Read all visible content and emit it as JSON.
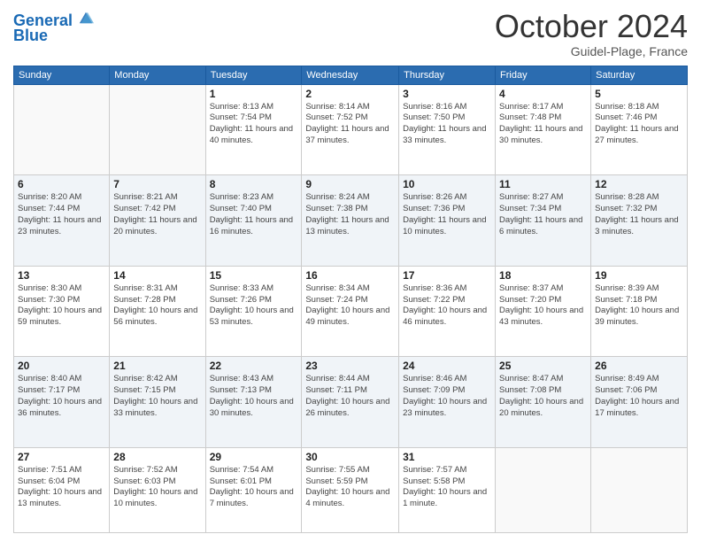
{
  "header": {
    "logo_line1": "General",
    "logo_line2": "Blue",
    "month": "October 2024",
    "location": "Guidel-Plage, France"
  },
  "days_of_week": [
    "Sunday",
    "Monday",
    "Tuesday",
    "Wednesday",
    "Thursday",
    "Friday",
    "Saturday"
  ],
  "weeks": [
    [
      {
        "num": "",
        "info": ""
      },
      {
        "num": "",
        "info": ""
      },
      {
        "num": "1",
        "info": "Sunrise: 8:13 AM\nSunset: 7:54 PM\nDaylight: 11 hours and 40 minutes."
      },
      {
        "num": "2",
        "info": "Sunrise: 8:14 AM\nSunset: 7:52 PM\nDaylight: 11 hours and 37 minutes."
      },
      {
        "num": "3",
        "info": "Sunrise: 8:16 AM\nSunset: 7:50 PM\nDaylight: 11 hours and 33 minutes."
      },
      {
        "num": "4",
        "info": "Sunrise: 8:17 AM\nSunset: 7:48 PM\nDaylight: 11 hours and 30 minutes."
      },
      {
        "num": "5",
        "info": "Sunrise: 8:18 AM\nSunset: 7:46 PM\nDaylight: 11 hours and 27 minutes."
      }
    ],
    [
      {
        "num": "6",
        "info": "Sunrise: 8:20 AM\nSunset: 7:44 PM\nDaylight: 11 hours and 23 minutes."
      },
      {
        "num": "7",
        "info": "Sunrise: 8:21 AM\nSunset: 7:42 PM\nDaylight: 11 hours and 20 minutes."
      },
      {
        "num": "8",
        "info": "Sunrise: 8:23 AM\nSunset: 7:40 PM\nDaylight: 11 hours and 16 minutes."
      },
      {
        "num": "9",
        "info": "Sunrise: 8:24 AM\nSunset: 7:38 PM\nDaylight: 11 hours and 13 minutes."
      },
      {
        "num": "10",
        "info": "Sunrise: 8:26 AM\nSunset: 7:36 PM\nDaylight: 11 hours and 10 minutes."
      },
      {
        "num": "11",
        "info": "Sunrise: 8:27 AM\nSunset: 7:34 PM\nDaylight: 11 hours and 6 minutes."
      },
      {
        "num": "12",
        "info": "Sunrise: 8:28 AM\nSunset: 7:32 PM\nDaylight: 11 hours and 3 minutes."
      }
    ],
    [
      {
        "num": "13",
        "info": "Sunrise: 8:30 AM\nSunset: 7:30 PM\nDaylight: 10 hours and 59 minutes."
      },
      {
        "num": "14",
        "info": "Sunrise: 8:31 AM\nSunset: 7:28 PM\nDaylight: 10 hours and 56 minutes."
      },
      {
        "num": "15",
        "info": "Sunrise: 8:33 AM\nSunset: 7:26 PM\nDaylight: 10 hours and 53 minutes."
      },
      {
        "num": "16",
        "info": "Sunrise: 8:34 AM\nSunset: 7:24 PM\nDaylight: 10 hours and 49 minutes."
      },
      {
        "num": "17",
        "info": "Sunrise: 8:36 AM\nSunset: 7:22 PM\nDaylight: 10 hours and 46 minutes."
      },
      {
        "num": "18",
        "info": "Sunrise: 8:37 AM\nSunset: 7:20 PM\nDaylight: 10 hours and 43 minutes."
      },
      {
        "num": "19",
        "info": "Sunrise: 8:39 AM\nSunset: 7:18 PM\nDaylight: 10 hours and 39 minutes."
      }
    ],
    [
      {
        "num": "20",
        "info": "Sunrise: 8:40 AM\nSunset: 7:17 PM\nDaylight: 10 hours and 36 minutes."
      },
      {
        "num": "21",
        "info": "Sunrise: 8:42 AM\nSunset: 7:15 PM\nDaylight: 10 hours and 33 minutes."
      },
      {
        "num": "22",
        "info": "Sunrise: 8:43 AM\nSunset: 7:13 PM\nDaylight: 10 hours and 30 minutes."
      },
      {
        "num": "23",
        "info": "Sunrise: 8:44 AM\nSunset: 7:11 PM\nDaylight: 10 hours and 26 minutes."
      },
      {
        "num": "24",
        "info": "Sunrise: 8:46 AM\nSunset: 7:09 PM\nDaylight: 10 hours and 23 minutes."
      },
      {
        "num": "25",
        "info": "Sunrise: 8:47 AM\nSunset: 7:08 PM\nDaylight: 10 hours and 20 minutes."
      },
      {
        "num": "26",
        "info": "Sunrise: 8:49 AM\nSunset: 7:06 PM\nDaylight: 10 hours and 17 minutes."
      }
    ],
    [
      {
        "num": "27",
        "info": "Sunrise: 7:51 AM\nSunset: 6:04 PM\nDaylight: 10 hours and 13 minutes."
      },
      {
        "num": "28",
        "info": "Sunrise: 7:52 AM\nSunset: 6:03 PM\nDaylight: 10 hours and 10 minutes."
      },
      {
        "num": "29",
        "info": "Sunrise: 7:54 AM\nSunset: 6:01 PM\nDaylight: 10 hours and 7 minutes."
      },
      {
        "num": "30",
        "info": "Sunrise: 7:55 AM\nSunset: 5:59 PM\nDaylight: 10 hours and 4 minutes."
      },
      {
        "num": "31",
        "info": "Sunrise: 7:57 AM\nSunset: 5:58 PM\nDaylight: 10 hours and 1 minute."
      },
      {
        "num": "",
        "info": ""
      },
      {
        "num": "",
        "info": ""
      }
    ]
  ]
}
